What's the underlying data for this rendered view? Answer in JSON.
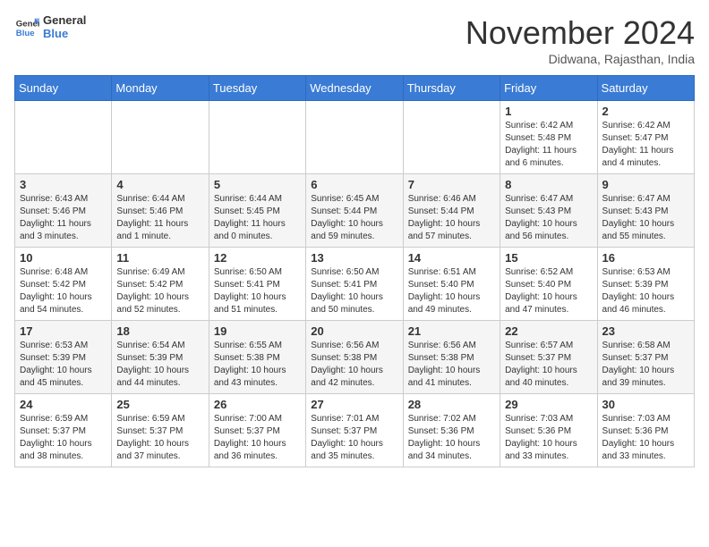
{
  "header": {
    "logo_general": "General",
    "logo_blue": "Blue",
    "month_title": "November 2024",
    "location": "Didwana, Rajasthan, India"
  },
  "weekdays": [
    "Sunday",
    "Monday",
    "Tuesday",
    "Wednesday",
    "Thursday",
    "Friday",
    "Saturday"
  ],
  "weeks": [
    [
      {
        "day": "",
        "info": ""
      },
      {
        "day": "",
        "info": ""
      },
      {
        "day": "",
        "info": ""
      },
      {
        "day": "",
        "info": ""
      },
      {
        "day": "",
        "info": ""
      },
      {
        "day": "1",
        "info": "Sunrise: 6:42 AM\nSunset: 5:48 PM\nDaylight: 11 hours\nand 6 minutes."
      },
      {
        "day": "2",
        "info": "Sunrise: 6:42 AM\nSunset: 5:47 PM\nDaylight: 11 hours\nand 4 minutes."
      }
    ],
    [
      {
        "day": "3",
        "info": "Sunrise: 6:43 AM\nSunset: 5:46 PM\nDaylight: 11 hours\nand 3 minutes."
      },
      {
        "day": "4",
        "info": "Sunrise: 6:44 AM\nSunset: 5:46 PM\nDaylight: 11 hours\nand 1 minute."
      },
      {
        "day": "5",
        "info": "Sunrise: 6:44 AM\nSunset: 5:45 PM\nDaylight: 11 hours\nand 0 minutes."
      },
      {
        "day": "6",
        "info": "Sunrise: 6:45 AM\nSunset: 5:44 PM\nDaylight: 10 hours\nand 59 minutes."
      },
      {
        "day": "7",
        "info": "Sunrise: 6:46 AM\nSunset: 5:44 PM\nDaylight: 10 hours\nand 57 minutes."
      },
      {
        "day": "8",
        "info": "Sunrise: 6:47 AM\nSunset: 5:43 PM\nDaylight: 10 hours\nand 56 minutes."
      },
      {
        "day": "9",
        "info": "Sunrise: 6:47 AM\nSunset: 5:43 PM\nDaylight: 10 hours\nand 55 minutes."
      }
    ],
    [
      {
        "day": "10",
        "info": "Sunrise: 6:48 AM\nSunset: 5:42 PM\nDaylight: 10 hours\nand 54 minutes."
      },
      {
        "day": "11",
        "info": "Sunrise: 6:49 AM\nSunset: 5:42 PM\nDaylight: 10 hours\nand 52 minutes."
      },
      {
        "day": "12",
        "info": "Sunrise: 6:50 AM\nSunset: 5:41 PM\nDaylight: 10 hours\nand 51 minutes."
      },
      {
        "day": "13",
        "info": "Sunrise: 6:50 AM\nSunset: 5:41 PM\nDaylight: 10 hours\nand 50 minutes."
      },
      {
        "day": "14",
        "info": "Sunrise: 6:51 AM\nSunset: 5:40 PM\nDaylight: 10 hours\nand 49 minutes."
      },
      {
        "day": "15",
        "info": "Sunrise: 6:52 AM\nSunset: 5:40 PM\nDaylight: 10 hours\nand 47 minutes."
      },
      {
        "day": "16",
        "info": "Sunrise: 6:53 AM\nSunset: 5:39 PM\nDaylight: 10 hours\nand 46 minutes."
      }
    ],
    [
      {
        "day": "17",
        "info": "Sunrise: 6:53 AM\nSunset: 5:39 PM\nDaylight: 10 hours\nand 45 minutes."
      },
      {
        "day": "18",
        "info": "Sunrise: 6:54 AM\nSunset: 5:39 PM\nDaylight: 10 hours\nand 44 minutes."
      },
      {
        "day": "19",
        "info": "Sunrise: 6:55 AM\nSunset: 5:38 PM\nDaylight: 10 hours\nand 43 minutes."
      },
      {
        "day": "20",
        "info": "Sunrise: 6:56 AM\nSunset: 5:38 PM\nDaylight: 10 hours\nand 42 minutes."
      },
      {
        "day": "21",
        "info": "Sunrise: 6:56 AM\nSunset: 5:38 PM\nDaylight: 10 hours\nand 41 minutes."
      },
      {
        "day": "22",
        "info": "Sunrise: 6:57 AM\nSunset: 5:37 PM\nDaylight: 10 hours\nand 40 minutes."
      },
      {
        "day": "23",
        "info": "Sunrise: 6:58 AM\nSunset: 5:37 PM\nDaylight: 10 hours\nand 39 minutes."
      }
    ],
    [
      {
        "day": "24",
        "info": "Sunrise: 6:59 AM\nSunset: 5:37 PM\nDaylight: 10 hours\nand 38 minutes."
      },
      {
        "day": "25",
        "info": "Sunrise: 6:59 AM\nSunset: 5:37 PM\nDaylight: 10 hours\nand 37 minutes."
      },
      {
        "day": "26",
        "info": "Sunrise: 7:00 AM\nSunset: 5:37 PM\nDaylight: 10 hours\nand 36 minutes."
      },
      {
        "day": "27",
        "info": "Sunrise: 7:01 AM\nSunset: 5:37 PM\nDaylight: 10 hours\nand 35 minutes."
      },
      {
        "day": "28",
        "info": "Sunrise: 7:02 AM\nSunset: 5:36 PM\nDaylight: 10 hours\nand 34 minutes."
      },
      {
        "day": "29",
        "info": "Sunrise: 7:03 AM\nSunset: 5:36 PM\nDaylight: 10 hours\nand 33 minutes."
      },
      {
        "day": "30",
        "info": "Sunrise: 7:03 AM\nSunset: 5:36 PM\nDaylight: 10 hours\nand 33 minutes."
      }
    ]
  ]
}
